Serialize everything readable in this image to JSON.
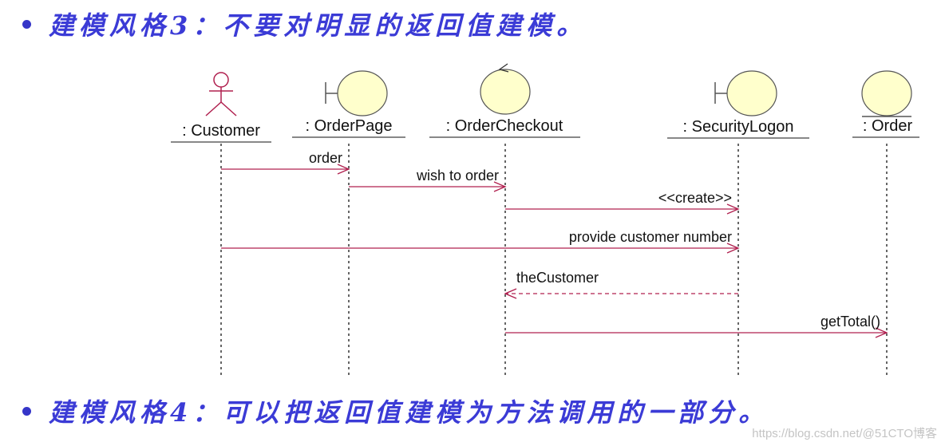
{
  "heading_top": {
    "text": "建模风格3：不要对明显的返回值建模。"
  },
  "heading_bottom": {
    "text": "建模风格4：可以把返回值建模为方法调用的一部分。"
  },
  "diagram": {
    "type": "sequence",
    "colors": {
      "message_line": "#b0204f",
      "actor": "#b0204f",
      "object_fill": "#ffffcc",
      "object_stroke": "#555555",
      "lifeline": "#333333",
      "heading_text": "#3b3bd6"
    },
    "participants": [
      {
        "id": "customer",
        "label": ": Customer",
        "kind": "actor"
      },
      {
        "id": "orderpage",
        "label": ": OrderPage",
        "kind": "boundary"
      },
      {
        "id": "ordercheckout",
        "label": ": OrderCheckout",
        "kind": "control"
      },
      {
        "id": "securitylogon",
        "label": ": SecurityLogon",
        "kind": "boundary"
      },
      {
        "id": "order",
        "label": ": Order",
        "kind": "entity"
      }
    ],
    "messages": [
      {
        "from": "customer",
        "to": "orderpage",
        "label": "order",
        "style": "solid"
      },
      {
        "from": "orderpage",
        "to": "ordercheckout",
        "label": "wish to order",
        "style": "solid"
      },
      {
        "from": "ordercheckout",
        "to": "securitylogon",
        "label": "<<create>>",
        "style": "solid"
      },
      {
        "from": "customer",
        "to": "securitylogon",
        "label": "provide customer number",
        "style": "solid"
      },
      {
        "from": "securitylogon",
        "to": "ordercheckout",
        "label": "theCustomer",
        "style": "dashed"
      },
      {
        "from": "ordercheckout",
        "to": "order",
        "label": "getTotal()",
        "style": "solid"
      }
    ]
  },
  "watermark": "https://blog.csdn.net/@51CTO博客"
}
